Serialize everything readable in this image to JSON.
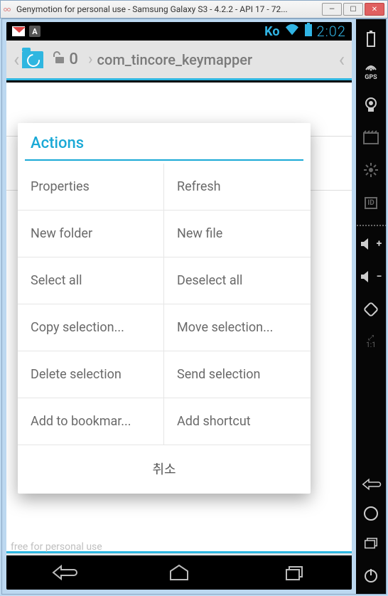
{
  "window": {
    "title": "Genymotion for personal use - Samsung Galaxy S3 - 4.2.2 - API 17 - 72..."
  },
  "statusbar": {
    "ime": "Ko",
    "clock": "2:02"
  },
  "app_toolbar": {
    "count": "0",
    "path": "com_tincore_keymapper"
  },
  "dialog": {
    "title": "Actions",
    "items": [
      [
        "Properties",
        "Refresh"
      ],
      [
        "New folder",
        "New file"
      ],
      [
        "Select all",
        "Deselect all"
      ],
      [
        "Copy selection...",
        "Move selection..."
      ],
      [
        "Delete selection",
        "Send selection"
      ],
      [
        "Add to bookmar...",
        "Add shortcut"
      ]
    ],
    "cancel": "취소"
  },
  "side_toolbar": {
    "gps_label": "GPS",
    "id_label": "ID",
    "ratio_label": "1:1"
  },
  "watermark": "free for personal use"
}
